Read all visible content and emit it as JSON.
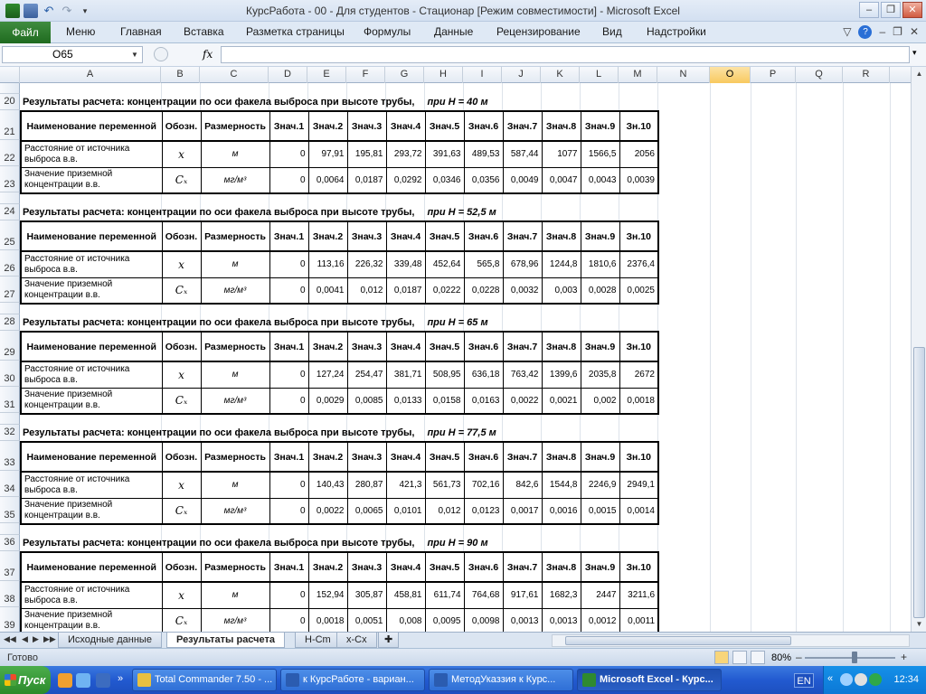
{
  "window": {
    "title": "КурсРабота - 00 - Для студентов - Стационар  [Режим совместимости]  -  Microsoft Excel"
  },
  "ribbon": {
    "file": "Файл",
    "tabs": [
      "Меню",
      "Главная",
      "Вставка",
      "Разметка страницы",
      "Формулы",
      "Данные",
      "Рецензирование",
      "Вид",
      "Надстройки"
    ]
  },
  "formula_bar": {
    "name_box": "O65",
    "fx": "fx",
    "value": ""
  },
  "columns": [
    "A",
    "B",
    "C",
    "D",
    "E",
    "F",
    "G",
    "H",
    "I",
    "J",
    "K",
    "L",
    "M",
    "N",
    "O",
    "P",
    "Q",
    "R"
  ],
  "selected_column": "O",
  "table_header": {
    "name": "Наименование переменной",
    "sym": "Обозн.",
    "unit": "Размерность",
    "values": [
      "Знач.1",
      "Знач.2",
      "Знач.3",
      "Знач.4",
      "Знач.5",
      "Знач.6",
      "Знач.7",
      "Знач.8",
      "Знач.9",
      "Зн.10"
    ]
  },
  "row_labels": {
    "distance": "Расстояние от источника выброса в.в.",
    "conc": "Значение приземной концентрации в.в.",
    "sym_x": "x",
    "sym_c": "Cₓ",
    "unit_m": "м",
    "unit_mg": "мг/м³"
  },
  "blocks": [
    {
      "rows": [
        "20",
        "21",
        "22",
        "23"
      ],
      "title": "Результаты расчета: концентрации по оси факела выброса при высоте трубы,",
      "subtitle": "при H = 40 м",
      "distance": [
        "0",
        "97,91",
        "195,81",
        "293,72",
        "391,63",
        "489,53",
        "587,44",
        "1077",
        "1566,5",
        "2056"
      ],
      "conc": [
        "0",
        "0,0064",
        "0,0187",
        "0,0292",
        "0,0346",
        "0,0356",
        "0,0049",
        "0,0047",
        "0,0043",
        "0,0039"
      ]
    },
    {
      "rows": [
        "24",
        "25",
        "26",
        "27"
      ],
      "title": "Результаты расчета: концентрации по оси факела выброса при высоте трубы,",
      "subtitle": "при H = 52,5 м",
      "distance": [
        "0",
        "113,16",
        "226,32",
        "339,48",
        "452,64",
        "565,8",
        "678,96",
        "1244,8",
        "1810,6",
        "2376,4"
      ],
      "conc": [
        "0",
        "0,0041",
        "0,012",
        "0,0187",
        "0,0222",
        "0,0228",
        "0,0032",
        "0,003",
        "0,0028",
        "0,0025"
      ]
    },
    {
      "rows": [
        "28",
        "29",
        "30",
        "31"
      ],
      "title": "Результаты расчета: концентрации по оси факела выброса при высоте трубы,",
      "subtitle": "при H = 65 м",
      "distance": [
        "0",
        "127,24",
        "254,47",
        "381,71",
        "508,95",
        "636,18",
        "763,42",
        "1399,6",
        "2035,8",
        "2672"
      ],
      "conc": [
        "0",
        "0,0029",
        "0,0085",
        "0,0133",
        "0,0158",
        "0,0163",
        "0,0022",
        "0,0021",
        "0,002",
        "0,0018"
      ]
    },
    {
      "rows": [
        "32",
        "33",
        "34",
        "35"
      ],
      "title": "Результаты расчета: концентрации по оси факела выброса при высоте трубы,",
      "subtitle": "при H = 77,5 м",
      "distance": [
        "0",
        "140,43",
        "280,87",
        "421,3",
        "561,73",
        "702,16",
        "842,6",
        "1544,8",
        "2246,9",
        "2949,1"
      ],
      "conc": [
        "0",
        "0,0022",
        "0,0065",
        "0,0101",
        "0,012",
        "0,0123",
        "0,0017",
        "0,0016",
        "0,0015",
        "0,0014"
      ]
    },
    {
      "rows": [
        "36",
        "37",
        "38",
        "39"
      ],
      "title": "Результаты расчета: концентрации по оси факела выброса при высоте трубы,",
      "subtitle": "при H = 90 м",
      "distance": [
        "0",
        "152,94",
        "305,87",
        "458,81",
        "611,74",
        "764,68",
        "917,61",
        "1682,3",
        "2447",
        "3211,6"
      ],
      "conc": [
        "0",
        "0,0018",
        "0,0051",
        "0,008",
        "0,0095",
        "0,0098",
        "0,0013",
        "0,0013",
        "0,0012",
        "0,0011"
      ]
    }
  ],
  "sheets": [
    "Исходные данные",
    "Результаты расчета",
    "H-Cm",
    "x-Cx"
  ],
  "active_sheet": "Результаты расчета",
  "status": {
    "ready": "Готово",
    "zoom": "80%"
  },
  "taskbar": {
    "start": "Пуск",
    "buttons": [
      "Total Commander 7.50 - ...",
      "к КурсРаботе - вариан...",
      "МетодУказзия к Курс...",
      "Microsoft Excel - Курс..."
    ],
    "active_button": "Microsoft Excel - Курс...",
    "lang": "EN",
    "clock": "12:34"
  },
  "colors": {
    "excel_green": "#1f6b1f",
    "ribbon_bg": "#dfe9f5",
    "selected_header": "#f8c95f",
    "taskbar_blue": "#225ad0"
  }
}
